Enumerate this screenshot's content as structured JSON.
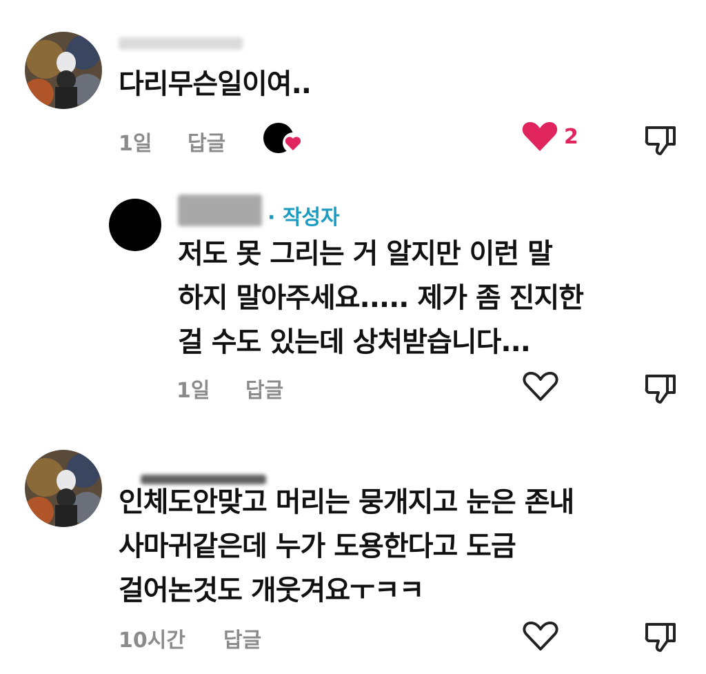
{
  "comments": [
    {
      "text": "다리무슨일이여..",
      "time": "1일",
      "reply_label": "답글",
      "like_count": "2",
      "liked": true,
      "liked_by_creator": true,
      "avatar_icon": "profile-illustration-avatar"
    },
    {
      "is_reply": true,
      "author_tag": "· 작성자",
      "text_lines": [
        "저도 못 그리는 거 알지만 이런 말",
        "하지 말아주세요..... 제가 좀 진지한",
        "걸 수도 있는데 상처받습니다..."
      ],
      "time": "1일",
      "reply_label": "답글",
      "liked": false
    },
    {
      "text_lines": [
        "인체도안맞고 머리는 뭉개지고 눈은 존내",
        "사마귀같은데 누가 도용한다고 도금",
        "걸어논것도 개웃겨요ㅜㅋㅋ"
      ],
      "time": "10시간",
      "reply_label": "답글",
      "liked": false
    }
  ],
  "colors": {
    "like_red": "#e0245e",
    "author_tag": "#1a9bbf",
    "meta_gray": "#8b8b8b"
  },
  "icons": [
    "heart-icon",
    "dislike-icon",
    "creator-liked-badge-icon"
  ]
}
